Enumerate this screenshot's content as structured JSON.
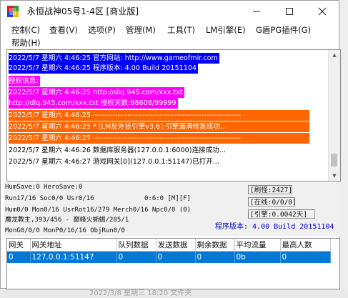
{
  "window": {
    "title": "永恒战神05号1-4区 [商业版]",
    "minimize_glyph": "—",
    "maximize_glyph": "☐",
    "close_glyph": "✕"
  },
  "menu": [
    {
      "label": "控制(C)"
    },
    {
      "label": "查看(V)"
    },
    {
      "label": "选项(P)"
    },
    {
      "label": "管理(M)"
    },
    {
      "label": "工具(T)"
    },
    {
      "label": "LM引擎(E)"
    },
    {
      "label": "G盾PG插件(G)"
    },
    {
      "label": "帮助(H)"
    }
  ],
  "log": [
    {
      "text": "2022/5/7 星期六 4:46:25 官方网站: http://www.gameofmir.com",
      "bg": "#0000ff",
      "fg": "#ffffff"
    },
    {
      "text": "2022/5/7 星期六 4:46:25 程序版本: 4.00 Build 20151104",
      "bg": "#0000ff",
      "fg": "#ffffff"
    },
    {
      "text": "授权信息:",
      "bg": "#ff00ff",
      "fg": "#ffffff"
    },
    {
      "text": "2022/5/7 星期六 4:46:25 http://dlq.945.com/xxx.txt",
      "bg": "#ff00ff",
      "fg": "#ffffff"
    },
    {
      "text": "http://dlq.945.com/xxx.txt 授权天数:98608/99999",
      "bg": "#ff00ff",
      "fg": "#ffffff"
    },
    {
      "text": "2022/5/7 星期六 4:46:25 ------------------------------------------------------------",
      "bg": "#ff6600",
      "fg": "#ffffff"
    },
    {
      "text": "2022/5/7 星期六 4:46:25 * [LM反外挂引擎v3.6]:引擎漏洞修复成功...",
      "bg": "#ff6600",
      "fg": "#ffffff"
    },
    {
      "text": "2022/5/7 星期六 4:46:25 ------------------------------------------------------------",
      "bg": "#ff6600",
      "fg": "#ffffff"
    },
    {
      "text": "2022/5/7 星期六 4:46:26 数据库服务器(127.0.0.1:6000)连接成功...",
      "bg": "#ffffff",
      "fg": "#000000"
    },
    {
      "text": "2022/5/7 星期六 4:46:27 游戏网关[0](127.0.0.1:51147)已打开...",
      "bg": "#ffffff",
      "fg": "#000000"
    }
  ],
  "scrollbar": {
    "up_glyph": "▲",
    "down_glyph": "▼"
  },
  "status": {
    "hum_save": "HumSave:0 HeroSave:0",
    "run": "Run17/16 Soc0/0 Usr0/16",
    "ratio": "0:6:0 [M][F]",
    "hum": "Hum0/0 Mon0/16 UsrRot16/279 Merch0/16 Npc0/0 (0)",
    "boss": "魔龙教主,393/456 - 巅峰火蜥蜴/285/1",
    "mon": "MonG0/0/0 MonP0/16/16 ObjRun0/0",
    "refresh": "[刷怪:2427]",
    "online": "[在线:0/0/0]",
    "engine": "[引擎:0.0042天]",
    "version": "程序版本: 4.00 Build 20151104",
    "version_color": "#0000cc"
  },
  "gateway_table": {
    "columns": [
      "网关",
      "网关地址",
      "队列数据",
      "发送数据",
      "剩余数据",
      "平均流量",
      "最高人数"
    ],
    "rows": [
      [
        "0",
        "127.0.0.1:51147",
        "0",
        "0",
        "0",
        "0b",
        "0"
      ]
    ]
  },
  "background": {
    "bottom_text": "2022/3/8 星期三 18:20      文件夹"
  }
}
